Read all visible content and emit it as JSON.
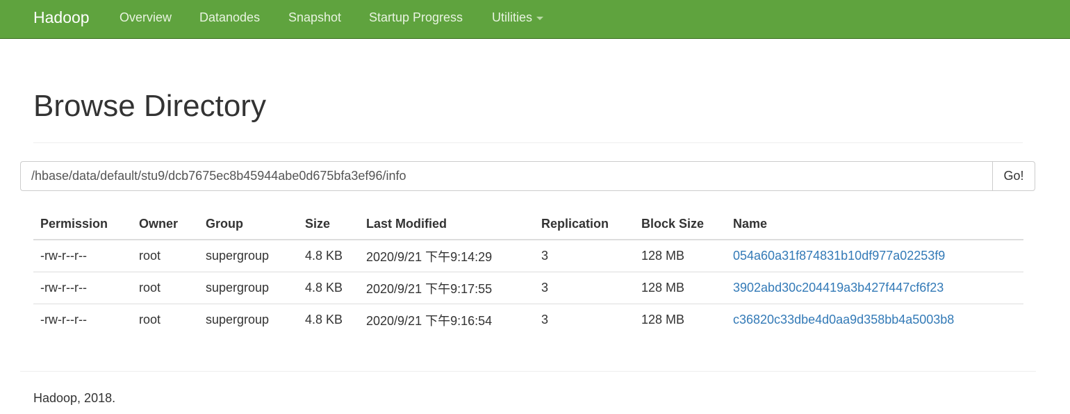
{
  "navbar": {
    "brand": "Hadoop",
    "items": [
      {
        "label": "Overview"
      },
      {
        "label": "Datanodes"
      },
      {
        "label": "Snapshot"
      },
      {
        "label": "Startup Progress"
      },
      {
        "label": "Utilities",
        "has_dropdown": true
      }
    ],
    "background_color": "#5fa33e"
  },
  "page": {
    "title": "Browse Directory"
  },
  "path_bar": {
    "value": "/hbase/data/default/stu9/dcb7675ec8b45944abe0d675bfa3ef96/info",
    "go_label": "Go!"
  },
  "table": {
    "columns": [
      "Permission",
      "Owner",
      "Group",
      "Size",
      "Last Modified",
      "Replication",
      "Block Size",
      "Name"
    ],
    "rows": [
      [
        "-rw-r--r--",
        "root",
        "supergroup",
        "4.8 KB",
        "2020/9/21 下午9:14:29",
        "3",
        "128 MB",
        "054a60a31f874831b10df977a02253f9"
      ],
      [
        "-rw-r--r--",
        "root",
        "supergroup",
        "4.8 KB",
        "2020/9/21 下午9:17:55",
        "3",
        "128 MB",
        "3902abd30c204419a3b427f447cf6f23"
      ],
      [
        "-rw-r--r--",
        "root",
        "supergroup",
        "4.8 KB",
        "2020/9/21 下午9:16:54",
        "3",
        "128 MB",
        "c36820c33dbe4d0aa9d358bb4a5003b8"
      ]
    ],
    "link_color": "#337ab7"
  },
  "footer": {
    "text": "Hadoop, 2018."
  }
}
